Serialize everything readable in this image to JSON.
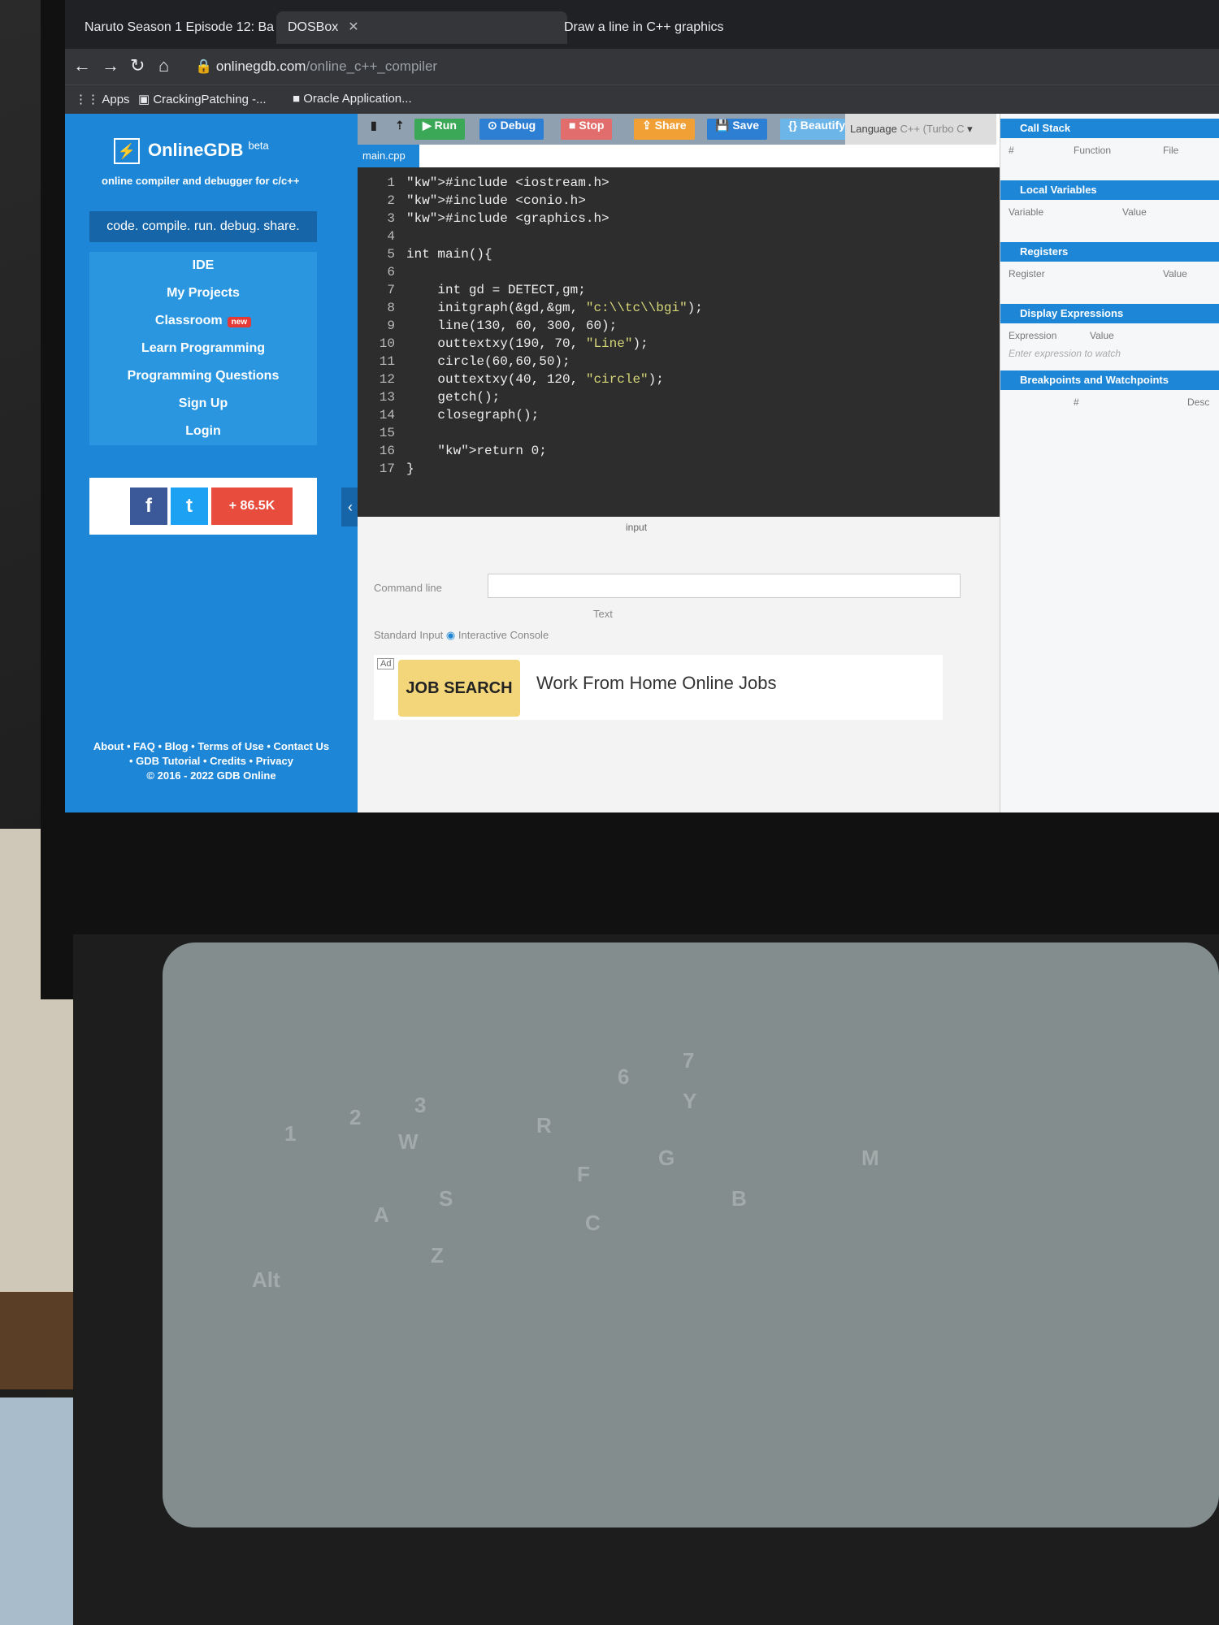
{
  "browser": {
    "tabs": [
      {
        "label": "Naruto Season 1 Episode 12: Ba"
      },
      {
        "label": "DOSBox"
      },
      {
        "label": "Draw a line in C++ graphics"
      }
    ],
    "url": {
      "domain": "onlinegdb.com",
      "path": "/online_c++_compiler"
    },
    "bookmarks": [
      "Apps",
      "CrackingPatching -...",
      "Oracle Application..."
    ]
  },
  "sidebar": {
    "logo": "OnlineGDB",
    "logo_sup": "beta",
    "tagline": "online compiler and debugger for c/c++",
    "motto": "code. compile. run. debug. share.",
    "nav": [
      "IDE",
      "My Projects",
      "Classroom",
      "Learn Programming",
      "Programming Questions",
      "Sign Up",
      "Login"
    ],
    "classroom_badge": "new",
    "social": {
      "facebook": "f",
      "twitter": "t",
      "share": "+",
      "share_count": "86.5K"
    },
    "footer_line1": "About • FAQ • Blog • Terms of Use • Contact Us",
    "footer_line2": "• GDB Tutorial • Credits • Privacy",
    "footer_line3": "© 2016 - 2022 GDB Online"
  },
  "toolbar": {
    "run": "Run",
    "debug": "Debug",
    "stop": "Stop",
    "share": "Share",
    "save": "Save",
    "beautify": "{} Beautify",
    "language_label": "Language",
    "language_value": "C++ (Turbo C"
  },
  "editor": {
    "file_tab": "main.cpp",
    "lines": [
      "#include <iostream.h>",
      "#include <conio.h>",
      "#include <graphics.h>",
      "",
      "int main(){",
      "",
      "    int gd = DETECT,gm;",
      "    initgraph(&gd,&gm, \"c:\\\\tc\\\\bgi\");",
      "    line(130, 60, 300, 60);",
      "    outtextxy(190, 70, \"Line\");",
      "    circle(60,60,50);",
      "    outtextxy(40, 120, \"circle\");",
      "    getch();",
      "    closegraph();",
      "",
      "    return 0;",
      "}"
    ]
  },
  "console": {
    "input_label": "input",
    "command_line_label": "Command line",
    "text_label": "Text",
    "standard_input_label": "Standard Input",
    "interactive_console_label": "Interactive Console",
    "ad_badge": "Ad",
    "ad_image_text": "JOB SEARCH",
    "ad_title": "Work From Home Online Jobs"
  },
  "debug_panel": {
    "call_stack": "Call Stack",
    "call_stack_cols": [
      "#",
      "Function",
      "File"
    ],
    "local_variables": "Local Variables",
    "local_cols": [
      "Variable",
      "Value"
    ],
    "registers": "Registers",
    "register_cols": [
      "Register",
      "Value"
    ],
    "display_expressions": "Display Expressions",
    "expr_cols": [
      "Expression",
      "Value"
    ],
    "expr_placeholder": "Enter expression to watch",
    "breakpoints": "Breakpoints and Watchpoints",
    "bp_cols": [
      "#",
      "Desc"
    ]
  },
  "keyboard": {
    "keys": [
      "1",
      "2",
      "3",
      "W",
      "A",
      "S",
      "Z",
      "6",
      "7",
      "R",
      "F",
      "C",
      "G",
      "B",
      "Y",
      "M",
      "Alt"
    ]
  }
}
